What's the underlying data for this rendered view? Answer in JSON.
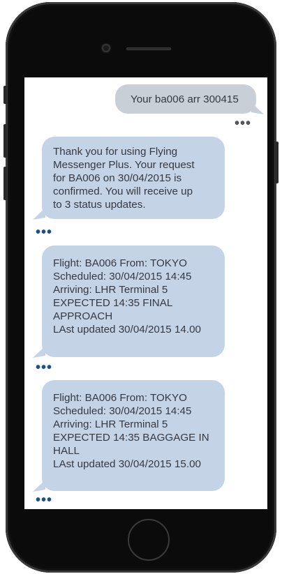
{
  "colors": {
    "incoming_bubble": "#c5d3e7",
    "outgoing_bubble": "#c9cfd6",
    "typing_dots_incoming": "#1e4e8c",
    "typing_dots_outgoing": "#555555",
    "phone_body": "#0b0b0b"
  },
  "typing_indicator": "•••",
  "messages": [
    {
      "direction": "outgoing",
      "text": "Your ba006 arr 300415"
    },
    {
      "direction": "incoming",
      "text": "Thank you for using Flying\nMessenger Plus. Your request\nfor BA006 on 30/04/2015 is\nconfirmed. You will receive up\nto 3 status updates."
    },
    {
      "direction": "incoming",
      "text": "Flight: BA006 From: TOKYO\nScheduled: 30/04/2015 14:45\nArriving: LHR Terminal 5\nEXPECTED 14:35 FINAL\nAPPROACH\nLAst updated 30/04/2015 14.00"
    },
    {
      "direction": "incoming",
      "text": "Flight: BA006 From: TOKYO\nScheduled: 30/04/2015 14:45\nArriving: LHR Terminal 5\nEXPECTED 14:35 BAGGAGE IN\nHALL\nLAst updated 30/04/2015 15.00"
    }
  ]
}
